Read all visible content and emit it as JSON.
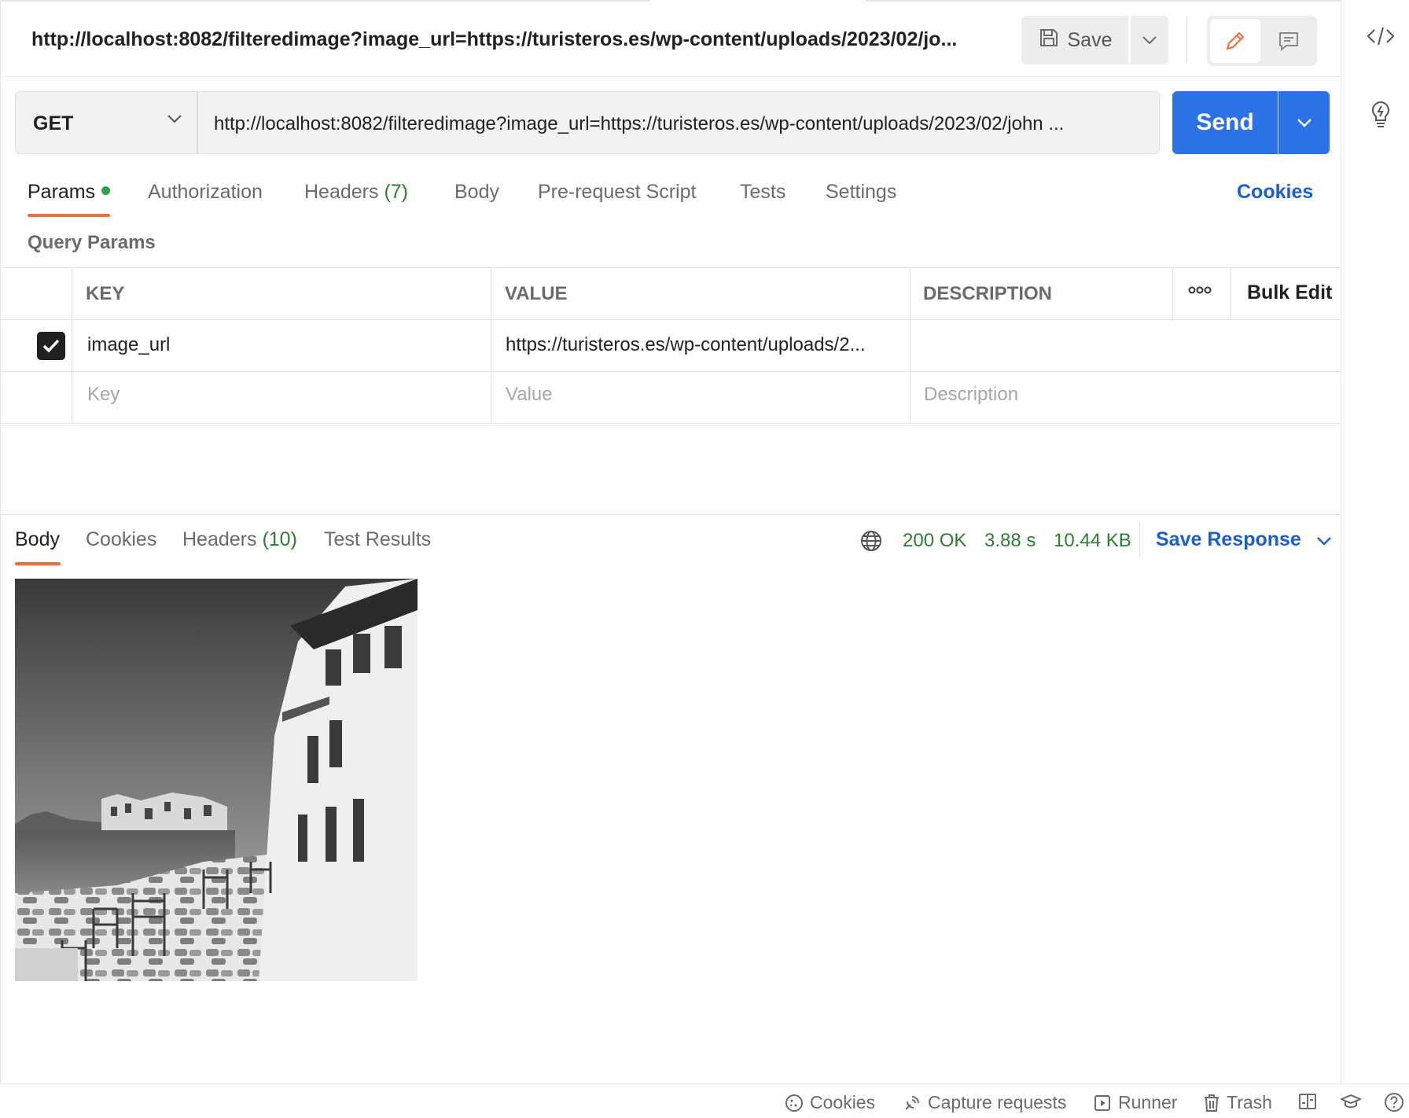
{
  "request": {
    "title": "http://localhost:8082/filteredimage?image_url=https://turisteros.es/wp-content/uploads/2023/02/jo...",
    "method": "GET",
    "url": "http://localhost:8082/filteredimage?image_url=https://turisteros.es/wp-content/uploads/2023/02/john ...",
    "save_label": "Save",
    "send_label": "Send"
  },
  "request_tabs": {
    "params": "Params",
    "authorization": "Authorization",
    "headers": "Headers",
    "headers_count": "(7)",
    "body": "Body",
    "prerequest": "Pre-request Script",
    "tests": "Tests",
    "settings": "Settings",
    "cookies": "Cookies"
  },
  "query_params": {
    "label": "Query Params",
    "columns": {
      "key": "KEY",
      "value": "VALUE",
      "description": "DESCRIPTION"
    },
    "bulk_edit": "Bulk Edit",
    "rows": [
      {
        "key": "image_url",
        "value": "https://turisteros.es/wp-content/uploads/2...",
        "description": "",
        "checked": true
      }
    ],
    "placeholders": {
      "key": "Key",
      "value": "Value",
      "description": "Description"
    }
  },
  "response": {
    "tabs": {
      "body": "Body",
      "cookies": "Cookies",
      "headers": "Headers",
      "headers_count": "(10)",
      "test_results": "Test Results"
    },
    "status": "200 OK",
    "time": "3.88 s",
    "size": "10.44 KB",
    "save_response": "Save Response"
  },
  "statusbar": {
    "cookies": "Cookies",
    "capture": "Capture requests",
    "runner": "Runner",
    "trash": "Trash"
  },
  "colors": {
    "accent": "#f26b3a",
    "primary": "#2a72e5",
    "success": "#2e7d32",
    "link": "#1a5fd0"
  }
}
